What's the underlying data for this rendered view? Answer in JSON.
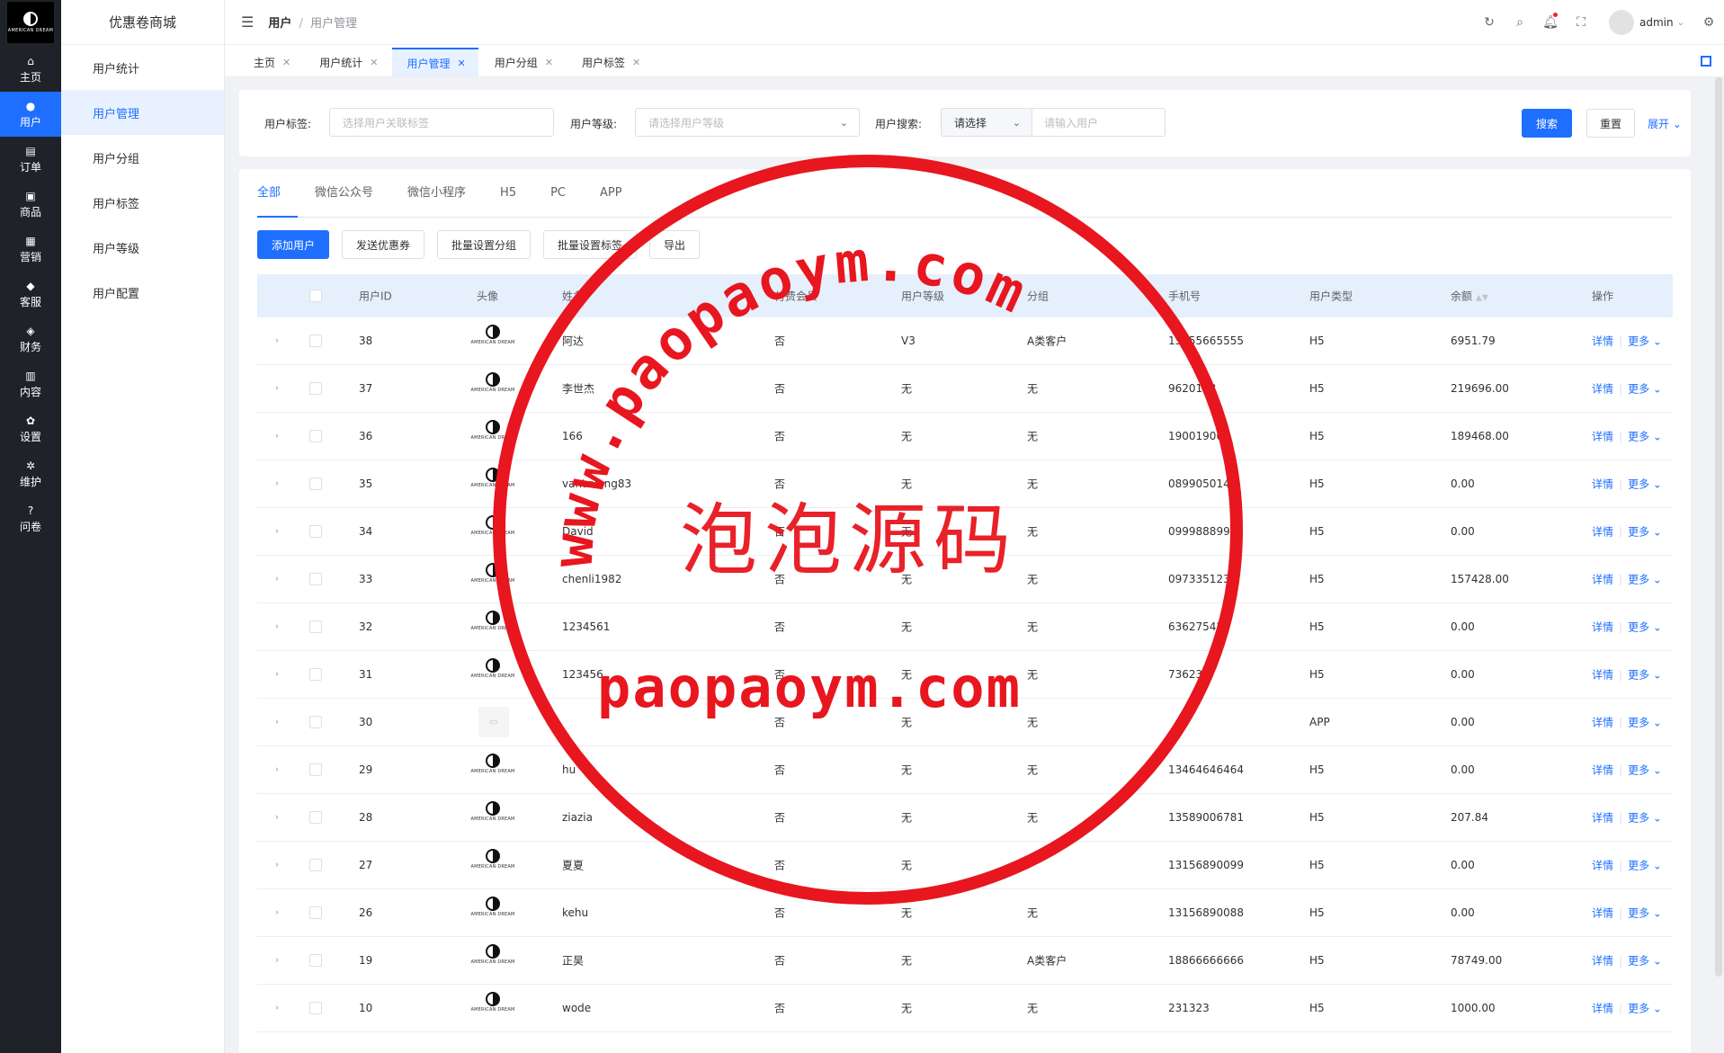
{
  "logo": {
    "text": "AMERICAN DREAM"
  },
  "main_nav": [
    {
      "icon": "home-icon",
      "label": "主页",
      "glyph": "⌂",
      "active": false
    },
    {
      "icon": "user-icon",
      "label": "用户",
      "glyph": "●",
      "active": true
    },
    {
      "icon": "order-icon",
      "label": "订单",
      "glyph": "▤",
      "active": false
    },
    {
      "icon": "goods-icon",
      "label": "商品",
      "glyph": "▣",
      "active": false
    },
    {
      "icon": "marketing-icon",
      "label": "营销",
      "glyph": "▦",
      "active": false
    },
    {
      "icon": "service-icon",
      "label": "客服",
      "glyph": "◆",
      "active": false
    },
    {
      "icon": "finance-icon",
      "label": "财务",
      "glyph": "◈",
      "active": false
    },
    {
      "icon": "content-icon",
      "label": "内容",
      "glyph": "▥",
      "active": false
    },
    {
      "icon": "settings-icon",
      "label": "设置",
      "glyph": "✿",
      "active": false
    },
    {
      "icon": "maintain-icon",
      "label": "维护",
      "glyph": "✲",
      "active": false
    },
    {
      "icon": "question-icon",
      "label": "问卷",
      "glyph": "?",
      "active": false
    }
  ],
  "sub_nav": {
    "brand": "优惠卷商城",
    "items": [
      {
        "label": "用户统计",
        "active": false
      },
      {
        "label": "用户管理",
        "active": true
      },
      {
        "label": "用户分组",
        "active": false
      },
      {
        "label": "用户标签",
        "active": false
      },
      {
        "label": "用户等级",
        "active": false
      },
      {
        "label": "用户配置",
        "active": false
      }
    ]
  },
  "header": {
    "breadcrumb": [
      "用户",
      "用户管理"
    ],
    "username": "admin"
  },
  "tabs": [
    {
      "label": "主页",
      "active": false
    },
    {
      "label": "用户统计",
      "active": false
    },
    {
      "label": "用户管理",
      "active": true
    },
    {
      "label": "用户分组",
      "active": false
    },
    {
      "label": "用户标签",
      "active": false
    }
  ],
  "filter": {
    "tag_label": "用户标签:",
    "tag_placeholder": "选择用户关联标签",
    "level_label": "用户等级:",
    "level_placeholder": "请选择用户等级",
    "search_label": "用户搜索:",
    "search_select": "请选择",
    "search_placeholder": "请输入用户",
    "search_button": "搜索",
    "reset_button": "重置",
    "expand_link": "展开"
  },
  "channel_tabs": [
    {
      "label": "全部",
      "active": true
    },
    {
      "label": "微信公众号",
      "active": false
    },
    {
      "label": "微信小程序",
      "active": false
    },
    {
      "label": "H5",
      "active": false
    },
    {
      "label": "PC",
      "active": false
    },
    {
      "label": "APP",
      "active": false
    }
  ],
  "actions": {
    "add": "添加用户",
    "coupon": "发送优惠券",
    "group": "批量设置分组",
    "tag": "批量设置标签",
    "export": "导出"
  },
  "table": {
    "headers": {
      "id": "用户ID",
      "avatar": "头像",
      "nickname": "姓名",
      "paid": "付费会员",
      "level": "用户等级",
      "group": "分组",
      "phone": "手机号",
      "type": "用户类型",
      "balance": "余额",
      "ops": "操作"
    },
    "detail_label": "详情",
    "more_label": "更多",
    "avatar_text": "AMERICAN DREAM",
    "rows": [
      {
        "id": "38",
        "nickname": "阿达",
        "paid": "否",
        "level": "V3",
        "group": "A类客户",
        "phone": "15555665555",
        "type": "H5",
        "balance": "6951.79",
        "avatar": true
      },
      {
        "id": "37",
        "nickname": "李世杰",
        "paid": "否",
        "level": "无",
        "group": "无",
        "phone": "9620153",
        "type": "H5",
        "balance": "219696.00",
        "avatar": true
      },
      {
        "id": "36",
        "nickname": "166",
        "paid": "否",
        "level": "无",
        "group": "无",
        "phone": "190019008",
        "type": "H5",
        "balance": "189468.00",
        "avatar": true
      },
      {
        "id": "35",
        "nickname": "vantruong83",
        "paid": "否",
        "level": "无",
        "group": "无",
        "phone": "0899050142",
        "type": "H5",
        "balance": "0.00",
        "avatar": true
      },
      {
        "id": "34",
        "nickname": "David",
        "paid": "否",
        "level": "无",
        "group": "无",
        "phone": "0999888999",
        "type": "H5",
        "balance": "0.00",
        "avatar": true
      },
      {
        "id": "33",
        "nickname": "chenli1982",
        "paid": "否",
        "level": "无",
        "group": "无",
        "phone": "0973351239",
        "type": "H5",
        "balance": "157428.00",
        "avatar": true
      },
      {
        "id": "32",
        "nickname": "1234561",
        "paid": "否",
        "level": "无",
        "group": "无",
        "phone": "636275423",
        "type": "H5",
        "balance": "0.00",
        "avatar": true
      },
      {
        "id": "31",
        "nickname": "123456",
        "paid": "否",
        "level": "无",
        "group": "无",
        "phone": "736234",
        "type": "H5",
        "balance": "0.00",
        "avatar": true
      },
      {
        "id": "30",
        "nickname": "",
        "paid": "否",
        "level": "无",
        "group": "无",
        "phone": "",
        "type": "APP",
        "balance": "0.00",
        "avatar": false
      },
      {
        "id": "29",
        "nickname": "hu",
        "paid": "否",
        "level": "无",
        "group": "无",
        "phone": "13464646464",
        "type": "H5",
        "balance": "0.00",
        "avatar": true
      },
      {
        "id": "28",
        "nickname": "ziazia",
        "paid": "否",
        "level": "无",
        "group": "无",
        "phone": "13589006781",
        "type": "H5",
        "balance": "207.84",
        "avatar": true
      },
      {
        "id": "27",
        "nickname": "夏夏",
        "paid": "否",
        "level": "无",
        "group": "",
        "phone": "13156890099",
        "type": "H5",
        "balance": "0.00",
        "avatar": true
      },
      {
        "id": "26",
        "nickname": "kehu",
        "paid": "否",
        "level": "无",
        "group": "无",
        "phone": "13156890088",
        "type": "H5",
        "balance": "0.00",
        "avatar": true
      },
      {
        "id": "19",
        "nickname": "正昊",
        "paid": "否",
        "level": "无",
        "group": "A类客户",
        "phone": "18866666666",
        "type": "H5",
        "balance": "78749.00",
        "avatar": true
      },
      {
        "id": "10",
        "nickname": "wode",
        "paid": "否",
        "level": "无",
        "group": "无",
        "phone": "231323",
        "type": "H5",
        "balance": "1000.00",
        "avatar": true
      }
    ]
  },
  "watermark": {
    "arc_text": "www.paopaoym.com",
    "cn_text": "泡泡源码",
    "url_text": "paopaoym.com",
    "color": "#e8161e"
  },
  "colors": {
    "primary": "#1e6fff",
    "nav_dark": "#1f2329"
  }
}
